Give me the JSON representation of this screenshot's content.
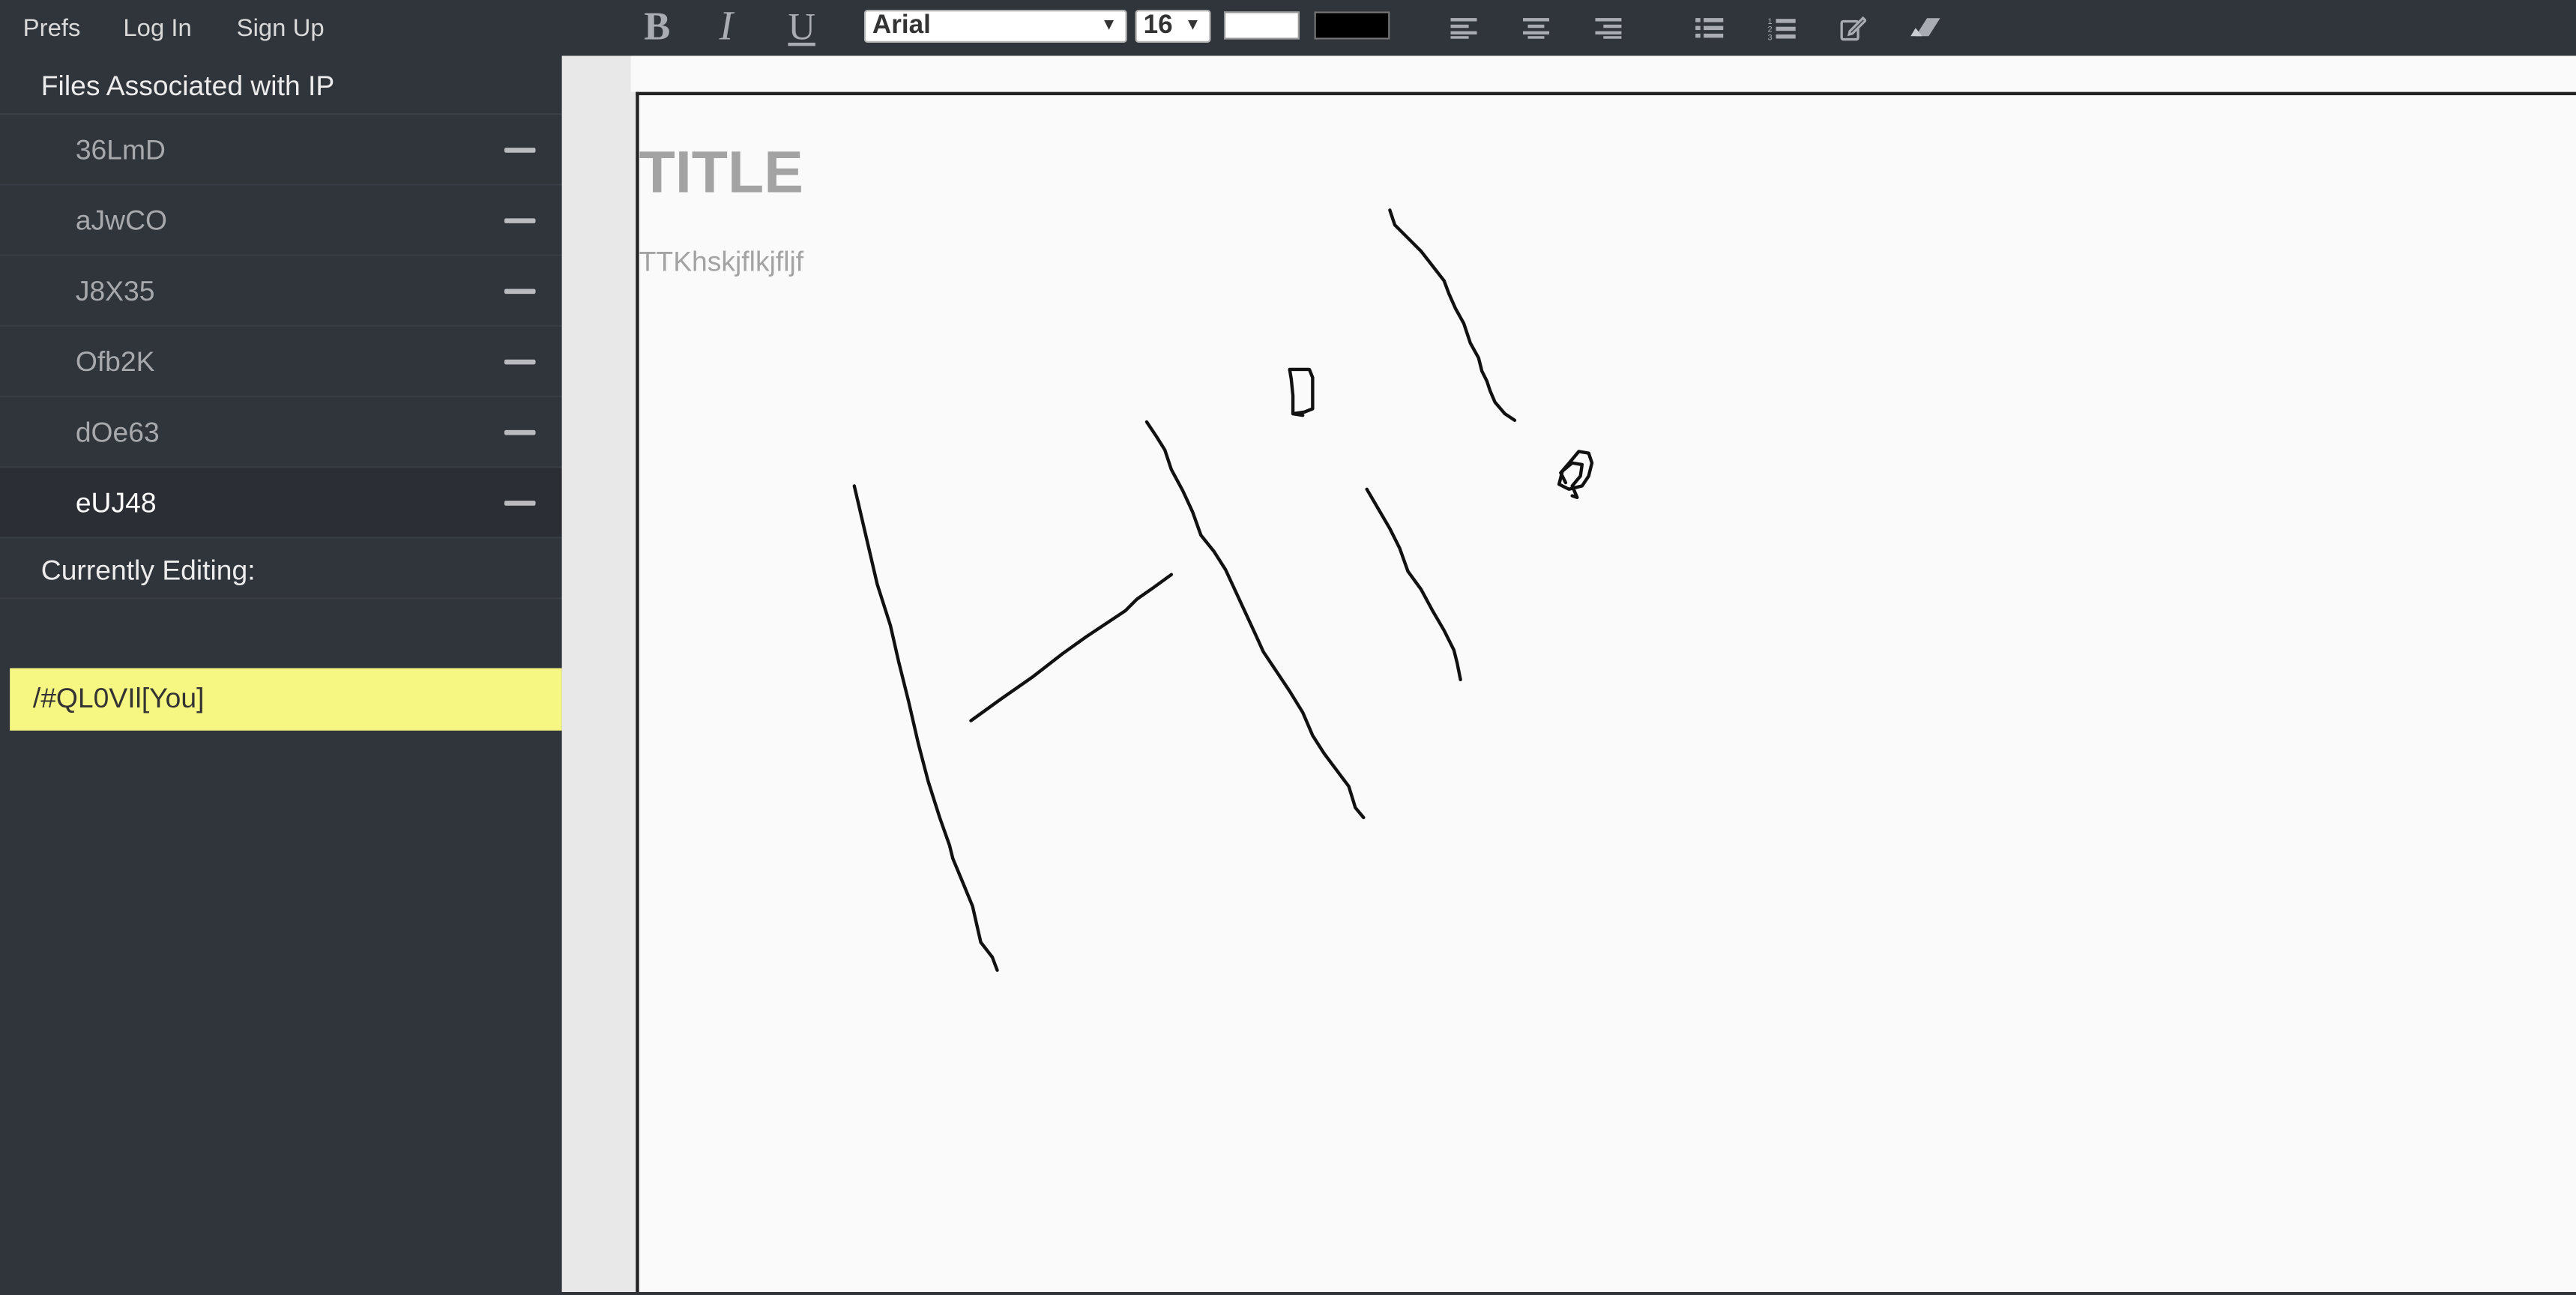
{
  "topbar": {
    "nav": {
      "prefs": "Prefs",
      "login": "Log In",
      "signup": "Sign Up"
    },
    "format": {
      "bold": "B",
      "italic": "I",
      "underline": "U"
    },
    "font_family": "Arial",
    "font_size": "16",
    "background_color": "#ffffff",
    "text_color": "#000000",
    "tool_icons": [
      "align-left-icon",
      "align-center-icon",
      "align-right-icon",
      "bulleted-list-icon",
      "numbered-list-icon",
      "edit-pencil-icon",
      "eraser-icon"
    ]
  },
  "sidebar": {
    "files_heading": "Files Associated with IP",
    "files": [
      {
        "name": "36LmD"
      },
      {
        "name": "aJwCO"
      },
      {
        "name": "J8X35"
      },
      {
        "name": "Ofb2K"
      },
      {
        "name": "dOe63"
      },
      {
        "name": "eUJ48",
        "active": true
      }
    ],
    "editing_heading": "Currently Editing:",
    "editing_user": "/#QL0VIl[You]",
    "editing_user_color": "#f6f783"
  },
  "document": {
    "title": "TITLE",
    "body": "TTKhskjflkjfljf",
    "ink_color": "#111111"
  }
}
